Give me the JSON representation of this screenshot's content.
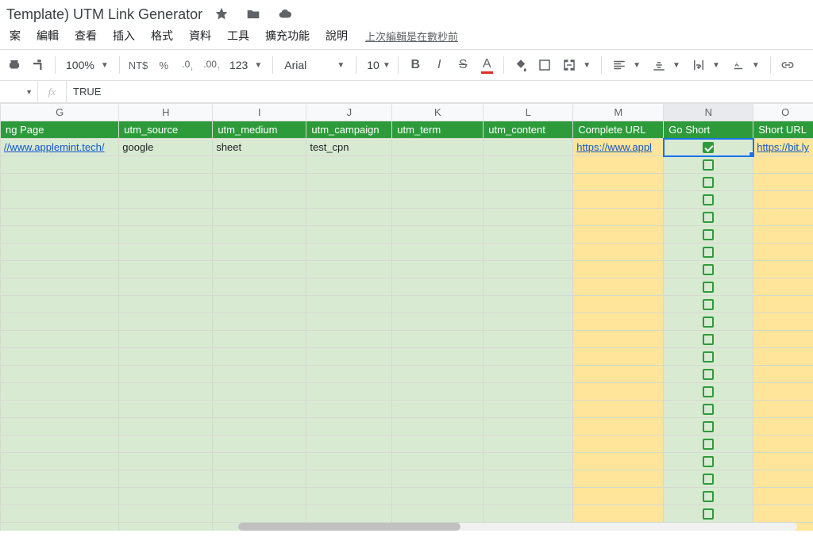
{
  "doc": {
    "title": "Template) UTM Link Generator",
    "last_edit": "上次編輯是在數秒前"
  },
  "menus": [
    "案",
    "編輯",
    "查看",
    "插入",
    "格式",
    "資料",
    "工具",
    "擴充功能",
    "說明"
  ],
  "toolbar": {
    "zoom": "100%",
    "currency": "NT$",
    "percent": "%",
    "dec_less": ".0",
    "dec_more": ".00",
    "numfmt": "123",
    "font": "Arial",
    "size": "10"
  },
  "formula": {
    "value": "TRUE"
  },
  "columns": [
    "G",
    "H",
    "I",
    "J",
    "K",
    "L",
    "M",
    "N",
    "O"
  ],
  "active_col": "N",
  "labels": {
    "G": "ng Page",
    "H": "utm_source",
    "I": "utm_medium",
    "J": "utm_campaign",
    "K": "utm_term",
    "L": "utm_content",
    "M": "Complete URL",
    "N": "Go Short",
    "O": "Short URL"
  },
  "row1": {
    "G": "//www.applemint.tech/",
    "H": "google",
    "I": "sheet",
    "J": "test_cpn",
    "K": "",
    "L": "",
    "M": "https://www.appl",
    "O": "https://bit.ly"
  },
  "total_rows": 23
}
